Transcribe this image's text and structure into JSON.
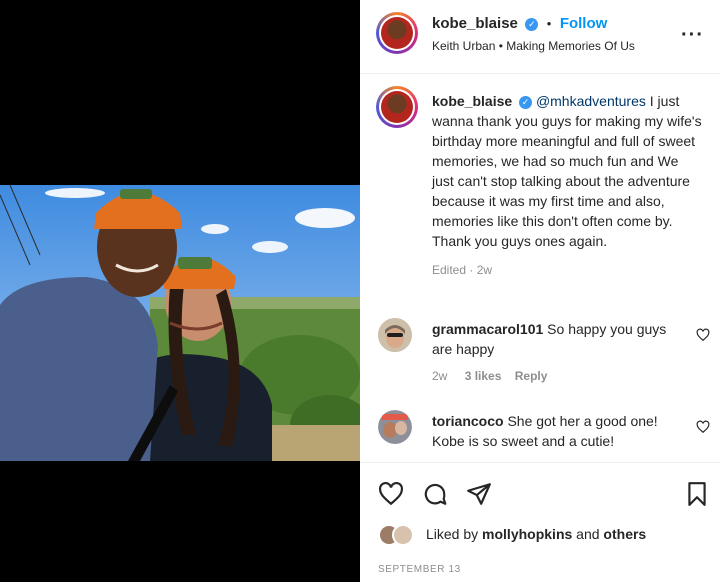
{
  "post": {
    "author": "kobe_blaise",
    "follow_label": "Follow",
    "audio_subtitle": "Keith Urban • Making Memories Of Us",
    "caption_mention": "@mhkadventures",
    "caption_text": " I just wanna thank you guys for making my wife's birthday more meaningful and full of sweet memories, we had so much fun and We just can't stop talking about the adventure because it was my first time and also, memories like this don't often come by. Thank you guys ones again.",
    "caption_meta": "Edited · 2w"
  },
  "comments": [
    {
      "user": "grammacarol101",
      "text": " So happy you guys are happy",
      "age": "2w",
      "likes": "3 likes",
      "reply": "Reply"
    },
    {
      "user": "toriancoco",
      "text": " She got her a good one! Kobe is so sweet and a cutie!"
    }
  ],
  "footer": {
    "liked_prefix": "Liked by ",
    "liked_user": "mollyhopkins",
    "liked_and": " and ",
    "liked_others": "others",
    "date": "SEPTEMBER 13"
  },
  "colors": {
    "accent": "#0095f6",
    "verified": "#3897f0",
    "helmet": "#e2701f"
  },
  "icons": [
    "more-options-icon",
    "verified-icon",
    "heart-icon",
    "comment-icon",
    "share-icon",
    "bookmark-icon"
  ]
}
